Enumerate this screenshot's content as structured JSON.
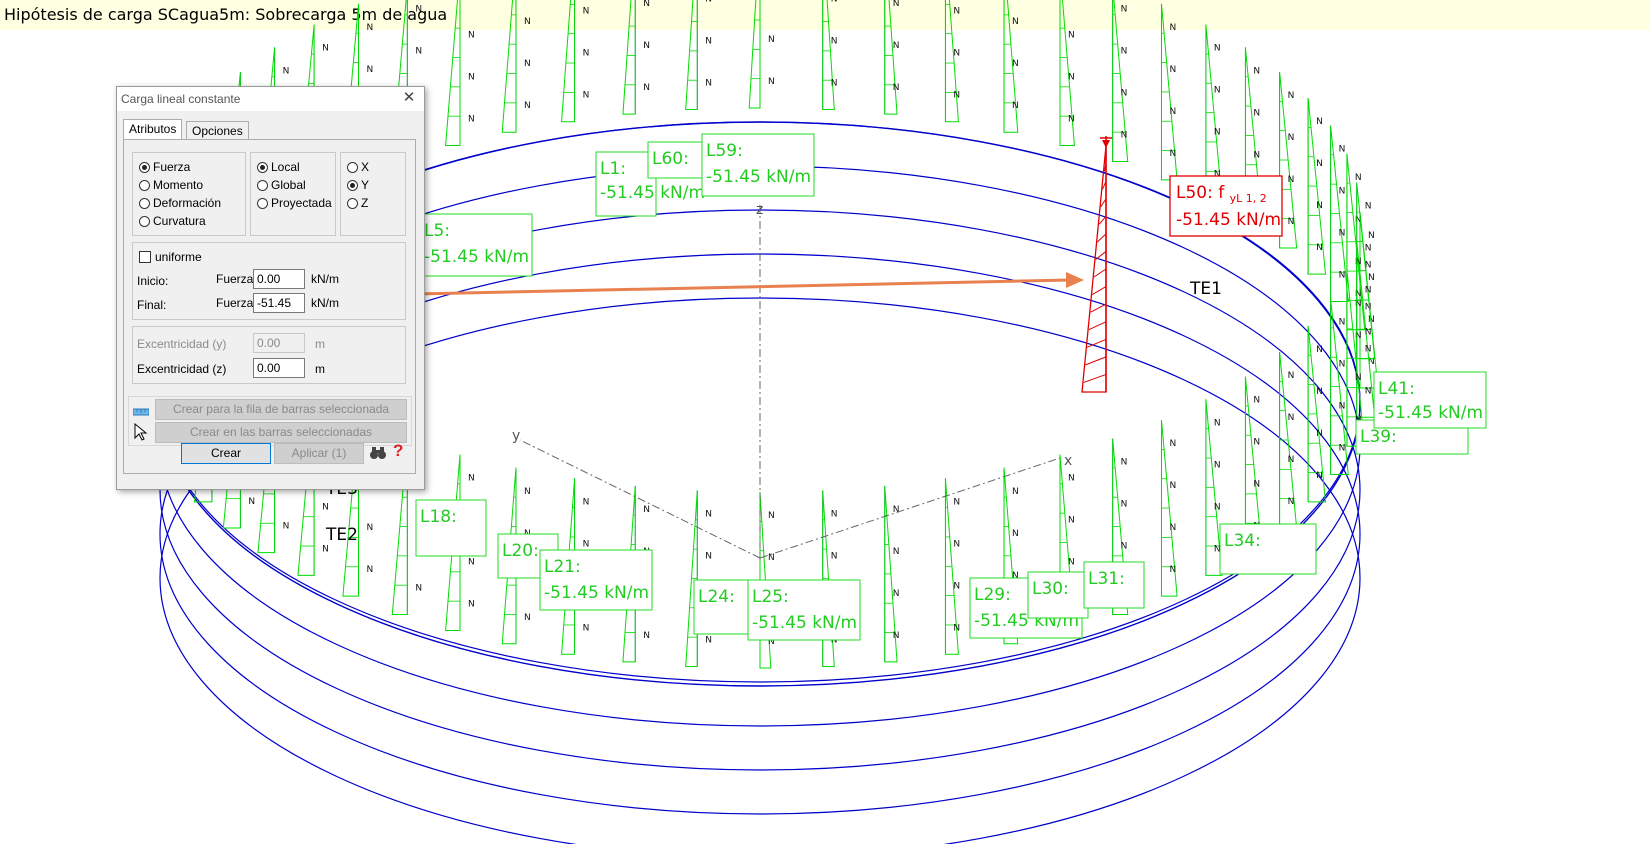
{
  "window_title": "Hipótesis de carga SCagua5m: Sobrecarga 5m de agua",
  "colors": {
    "title_background": "#ffffe2",
    "beam": "#0000cc",
    "load": "#00dd00",
    "selected": "#e10000",
    "arrow": "#e8804f",
    "axis": "#555555"
  },
  "dialog": {
    "title": "Carga lineal constante",
    "tabs": [
      "Atributos",
      "Opciones"
    ],
    "active_tab": "Atributos",
    "load_type": {
      "options": [
        "Fuerza",
        "Momento",
        "Deformación",
        "Curvatura"
      ],
      "selected": "Fuerza"
    },
    "reference": {
      "options": [
        "Local",
        "Global",
        "Proyectada"
      ],
      "selected": "Local"
    },
    "direction": {
      "options": [
        "X",
        "Y",
        "Z"
      ],
      "selected": "Y"
    },
    "uniform_label": "uniforme",
    "uniform_checked": false,
    "start_label": "Inicio:",
    "start_quantity": "Fuerza",
    "start_value": "0.00",
    "start_unit": "kN/m",
    "end_label": "Final:",
    "end_quantity": "Fuerza",
    "end_value": "-51.45",
    "end_unit": "kN/m",
    "ecc_y_label": "Excentricidad (y)",
    "ecc_y_value": "0.00",
    "ecc_y_unit": "m",
    "ecc_z_label": "Excentricidad (z)",
    "ecc_z_value": "0.00",
    "ecc_z_unit": "m",
    "create_row_button": "Crear para la fila de barras seleccionada",
    "create_selected_button": "Crear en las barras seleccionadas",
    "create_button": "Crear",
    "apply_button": "Aplicar (1)",
    "help_icon": "?"
  },
  "model": {
    "load_value": "-51.45 kN/m",
    "load_symbol": "f",
    "load_subscript": "yL 1, 2",
    "selected_label_name": "L50:",
    "labels": [
      {
        "name": "L1:"
      },
      {
        "name": "L60:"
      },
      {
        "name": "L59:"
      },
      {
        "name": "L5:"
      },
      {
        "name": "L18:"
      },
      {
        "name": "L20:"
      },
      {
        "name": "L21:"
      },
      {
        "name": "L24:"
      },
      {
        "name": "L25:"
      },
      {
        "name": "L29:"
      },
      {
        "name": "L30:"
      },
      {
        "name": "L31:"
      },
      {
        "name": "L34:"
      },
      {
        "name": "L39:"
      },
      {
        "name": "L41:"
      }
    ],
    "element_labels": [
      "TE1",
      "TE2",
      "TE3"
    ],
    "axes": [
      "x",
      "y",
      "z"
    ],
    "member_marker": "N"
  }
}
